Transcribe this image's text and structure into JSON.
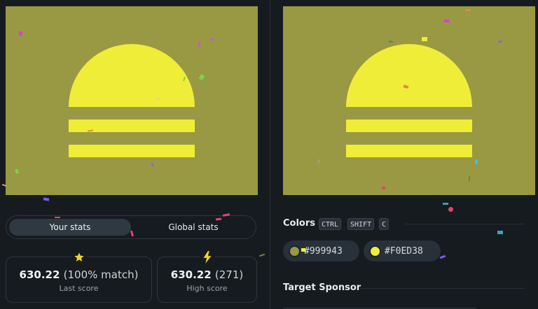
{
  "puzzle": {
    "background_color": "#999943",
    "shape_color": "#F0ED38"
  },
  "stats": {
    "tabs": [
      {
        "label": "Your stats",
        "active": true
      },
      {
        "label": "Global stats",
        "active": false
      }
    ],
    "last_score": {
      "value": "630.22",
      "detail": "(100% match)",
      "label": "Last score",
      "icon": "star-icon"
    },
    "high_score": {
      "value": "630.22",
      "detail": "(271)",
      "label": "High score",
      "icon": "lightning-icon"
    }
  },
  "colors_section": {
    "title": "Colors",
    "shortcut_keys": [
      "CTRL",
      "SHIFT",
      "C"
    ],
    "swatches": [
      {
        "hex": "#999943",
        "color": "#999943"
      },
      {
        "hex": "#F0ED38",
        "color": "#F0ED38"
      }
    ]
  },
  "sponsor_section": {
    "title": "Target Sponsor"
  }
}
